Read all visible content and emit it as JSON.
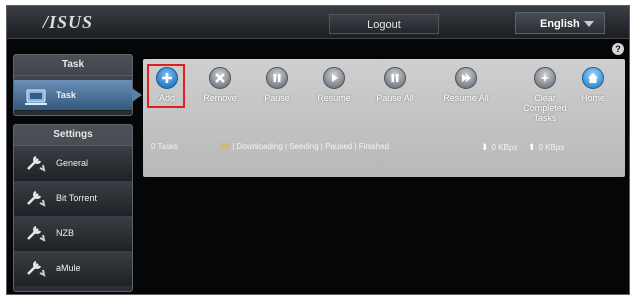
{
  "header": {
    "logo_text": "/ISUS",
    "logout_label": "Logout",
    "language_label": "English",
    "help_label": "?"
  },
  "sidebar": {
    "task_section": {
      "title": "Task",
      "items": [
        {
          "label": "Task",
          "icon": "task-icon",
          "active": true
        }
      ]
    },
    "settings_section": {
      "title": "Settings",
      "items": [
        {
          "label": "General",
          "icon": "wrench-icon"
        },
        {
          "label": "Bit Torrent",
          "icon": "wrench-icon"
        },
        {
          "label": "NZB",
          "icon": "wrench-icon"
        },
        {
          "label": "aMule",
          "icon": "wrench-icon"
        }
      ]
    }
  },
  "toolbar": {
    "add": "Add",
    "remove": "Remove",
    "pause": "Pause",
    "resume": "Resume",
    "pause_all": "Pause All",
    "resume_all": "Resume All",
    "clear_completed": "Clear Completed Tasks",
    "home": "Home"
  },
  "status": {
    "task_count": "0 Tasks",
    "filters": [
      "All",
      "Downloading",
      "Seeding",
      "Paused",
      "Finished"
    ],
    "filter_separator": " | ",
    "download_rate": "0 KBps",
    "upload_rate": "0 KBps"
  },
  "colors": {
    "accent": "#2a7fc6",
    "highlight": "#e02020",
    "selected_filter": "#f5a623",
    "panel": "#c9c9c9"
  }
}
